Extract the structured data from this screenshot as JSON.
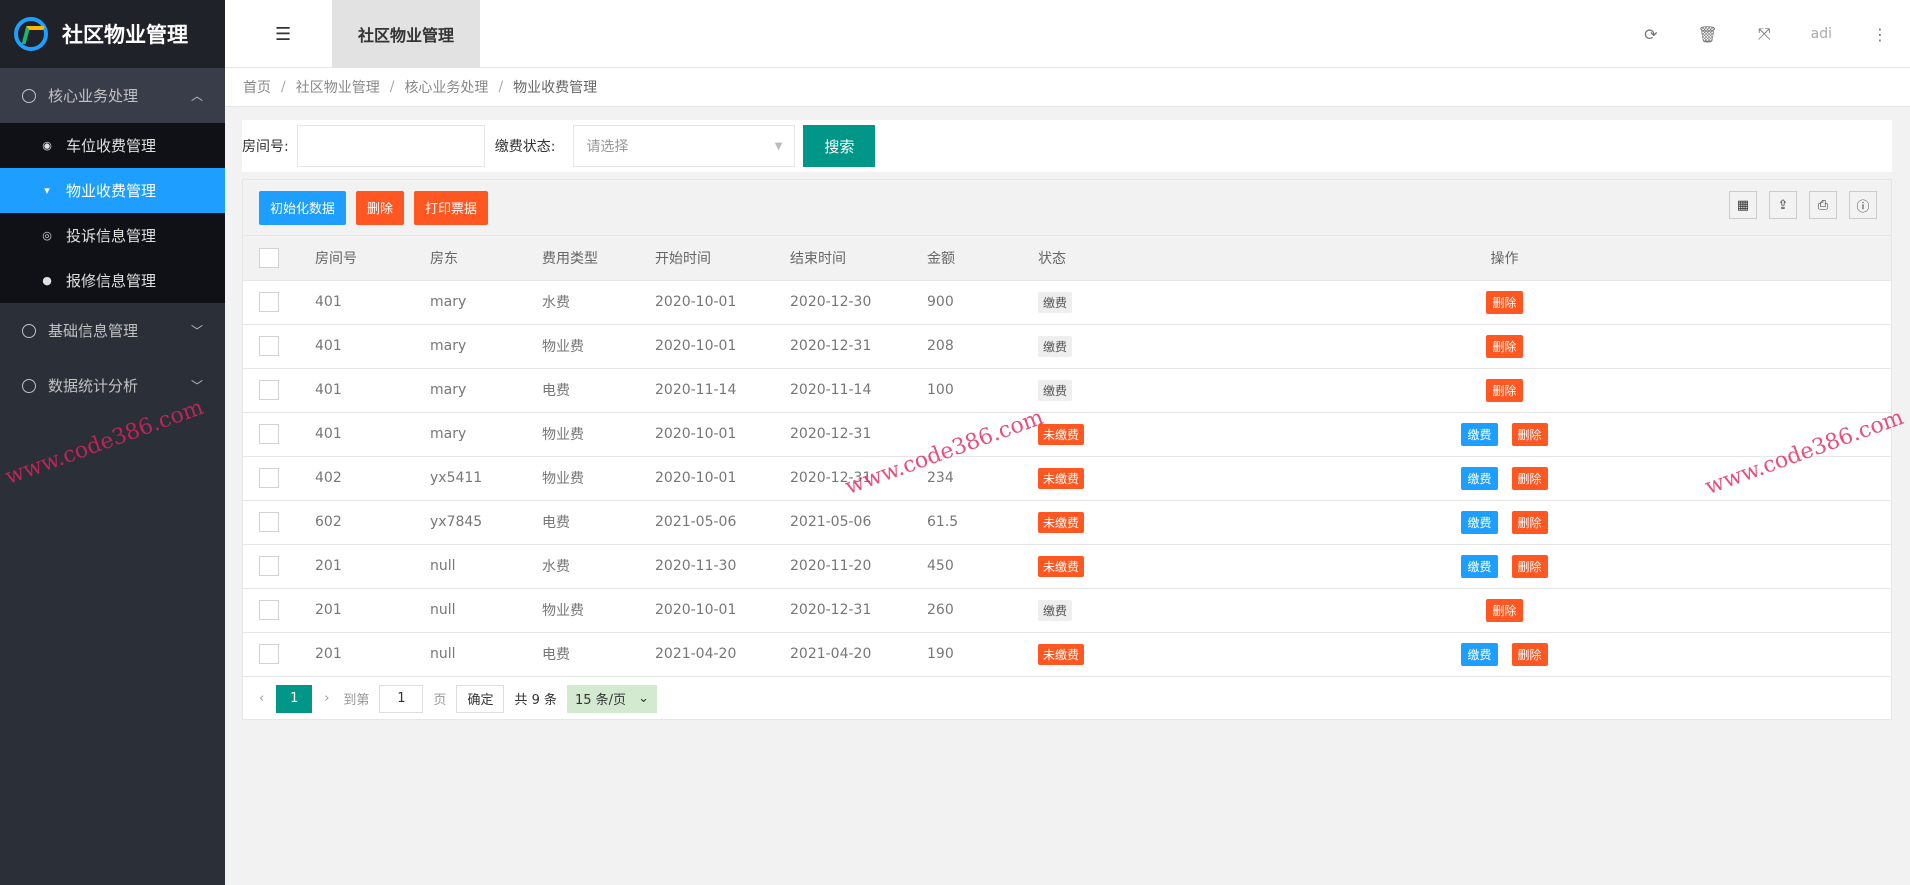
{
  "app": {
    "title": "社区物业管理"
  },
  "sidebar": {
    "groups": [
      {
        "label": "核心业务处理",
        "chevron": "chevron-up-icon",
        "items": [
          {
            "label": "车位收费管理",
            "icon": "dashboard-icon"
          },
          {
            "label": "物业收费管理",
            "icon": "chevron-down-icon",
            "active": true
          },
          {
            "label": "投诉信息管理",
            "icon": "target-icon"
          },
          {
            "label": "报修信息管理",
            "icon": "navigation-icon"
          }
        ]
      },
      {
        "label": "基础信息管理",
        "chevron": "chevron-down-icon"
      },
      {
        "label": "数据统计分析",
        "chevron": "chevron-down-icon"
      }
    ]
  },
  "header": {
    "tab": "社区物业管理",
    "user": "adi"
  },
  "breadcrumb": [
    "首页",
    "社区物业管理",
    "核心业务处理",
    "物业收费管理"
  ],
  "search": {
    "room_label": "房间号:",
    "room_value": "",
    "status_label": "缴费状态:",
    "status_placeholder": "请选择",
    "button": "搜索"
  },
  "toolbar": {
    "init": "初始化数据",
    "delete": "删除",
    "print": "打印票据"
  },
  "table": {
    "columns": [
      "房间号",
      "房东",
      "费用类型",
      "开始时间",
      "结束时间",
      "金额",
      "状态",
      "操作"
    ],
    "rows": [
      {
        "room": "401",
        "owner": "mary",
        "type": "水费",
        "start": "2020-10-01",
        "end": "2020-12-30",
        "amount": "900",
        "status": "缴费",
        "paid": true
      },
      {
        "room": "401",
        "owner": "mary",
        "type": "物业费",
        "start": "2020-10-01",
        "end": "2020-12-31",
        "amount": "208",
        "status": "缴费",
        "paid": true
      },
      {
        "room": "401",
        "owner": "mary",
        "type": "电费",
        "start": "2020-11-14",
        "end": "2020-11-14",
        "amount": "100",
        "status": "缴费",
        "paid": true
      },
      {
        "room": "401",
        "owner": "mary",
        "type": "物业费",
        "start": "2020-10-01",
        "end": "2020-12-31",
        "amount": "",
        "status": "未缴费",
        "paid": false
      },
      {
        "room": "402",
        "owner": "yx5411",
        "type": "物业费",
        "start": "2020-10-01",
        "end": "2020-12-31",
        "amount": "234",
        "status": "未缴费",
        "paid": false
      },
      {
        "room": "602",
        "owner": "yx7845",
        "type": "电费",
        "start": "2021-05-06",
        "end": "2021-05-06",
        "amount": "61.5",
        "status": "未缴费",
        "paid": false
      },
      {
        "room": "201",
        "owner": "null",
        "type": "水费",
        "start": "2020-11-30",
        "end": "2020-11-20",
        "amount": "450",
        "status": "未缴费",
        "paid": false
      },
      {
        "room": "201",
        "owner": "null",
        "type": "物业费",
        "start": "2020-10-01",
        "end": "2020-12-31",
        "amount": "260",
        "status": "缴费",
        "paid": true
      },
      {
        "room": "201",
        "owner": "null",
        "type": "电费",
        "start": "2021-04-20",
        "end": "2021-04-20",
        "amount": "190",
        "status": "未缴费",
        "paid": false
      }
    ],
    "pay_label": "缴费",
    "delete_label": "删除"
  },
  "pagination": {
    "current": "1",
    "goto": "到第",
    "page_input": "1",
    "page_unit": "页",
    "confirm": "确定",
    "total": "共 9 条",
    "page_size": "15 条/页"
  },
  "watermark": "www.code386.com",
  "colors": {
    "primary": "#009688",
    "blue": "#1e9fff",
    "orange": "#ff5722",
    "sidebar": "#2a2f38"
  }
}
